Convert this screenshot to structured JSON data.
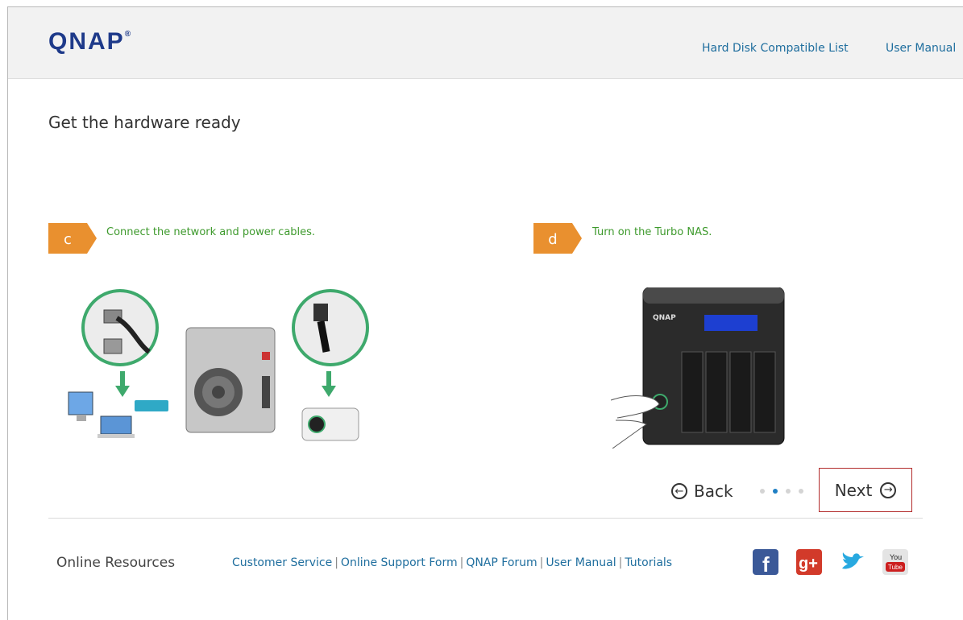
{
  "header": {
    "logo": "QNAP",
    "links": [
      "Hard Disk Compatible List",
      "User Manual"
    ]
  },
  "page": {
    "title": "Get the hardware ready"
  },
  "steps": [
    {
      "letter": "c",
      "text": "Connect the network and power cables."
    },
    {
      "letter": "d",
      "text": "Turn on the Turbo NAS."
    }
  ],
  "nav": {
    "back_label": "Back",
    "next_label": "Next",
    "pager": {
      "total": 4,
      "current": 2
    }
  },
  "footer": {
    "title": "Online Resources",
    "links": [
      "Customer Service",
      "Online Support Form",
      "QNAP Forum",
      "User Manual",
      "Tutorials"
    ],
    "social": [
      "facebook-icon",
      "google-plus-icon",
      "twitter-icon",
      "youtube-icon"
    ]
  },
  "colors": {
    "brand": "#1e3a8a",
    "step_badge": "#e9902f",
    "step_text": "#3e9a2d",
    "link": "#1f6e9e",
    "next_highlight": "#b22a2a"
  }
}
